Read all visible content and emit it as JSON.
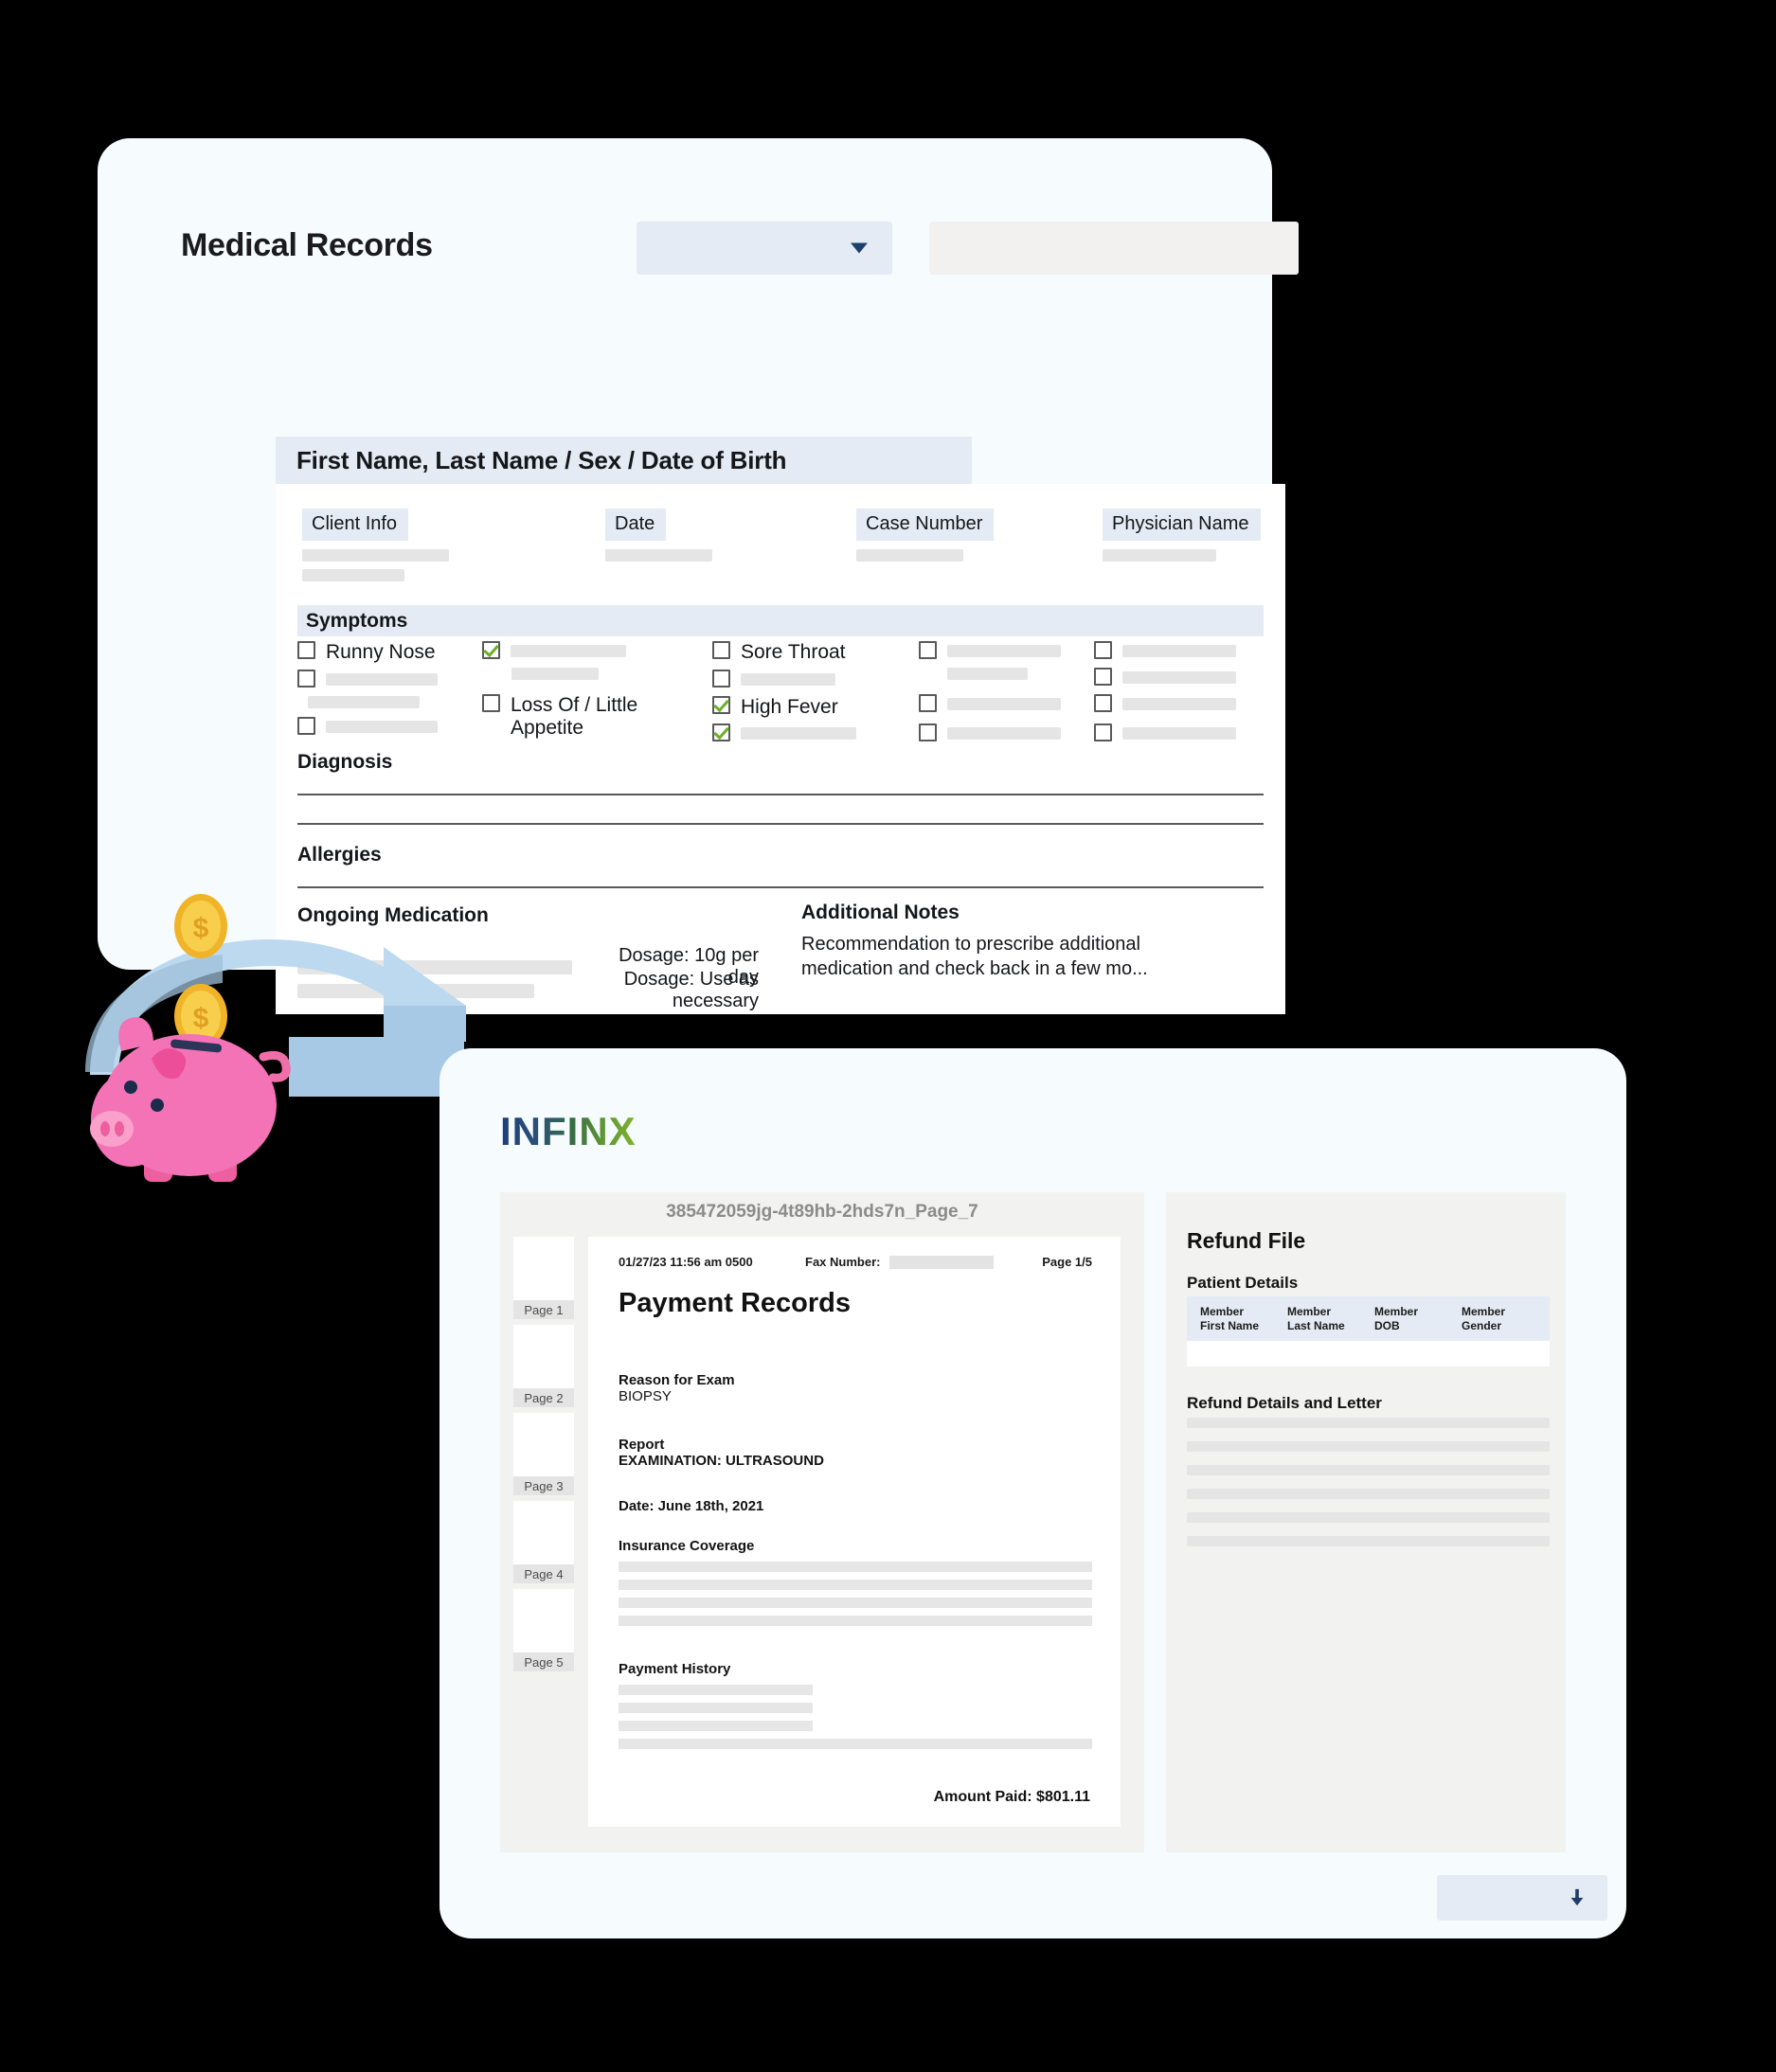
{
  "medical_card": {
    "title": "Medical Records",
    "select": {
      "value": "",
      "icon": "chevron-down-icon"
    },
    "textfield": {
      "value": ""
    },
    "name_bar": "First Name, Last Name / Sex / Date of Birth",
    "info_columns": [
      {
        "label": "Client Info",
        "bars": [
          155,
          108
        ]
      },
      {
        "label": "Date",
        "bars": [
          113
        ]
      },
      {
        "label": "Case Number",
        "bars": [
          113
        ]
      },
      {
        "label": "Physician Name",
        "bars": [
          120
        ]
      }
    ],
    "symptoms_header": "Symptoms",
    "symptoms": [
      {
        "checked": false,
        "label": "Runny Nose",
        "bar": 0
      },
      {
        "checked": false,
        "label": "",
        "bar": 118
      },
      {
        "checked": false,
        "label": "",
        "bar": 118
      },
      {
        "checked": true,
        "label": "",
        "bar": 122
      },
      {
        "checked": false,
        "label": "",
        "bar": 92
      },
      {
        "checked": false,
        "label": "Loss Of / Little\nAppetite",
        "bar": 0
      },
      {
        "checked": false,
        "label": "Sore Throat",
        "bar": 0
      },
      {
        "checked": false,
        "label": "",
        "bar": 100
      },
      {
        "checked": true,
        "label": "High Fever",
        "bar": 0
      },
      {
        "checked": true,
        "label": "",
        "bar": 122
      },
      {
        "checked": false,
        "label": "",
        "bar": 120
      },
      {
        "checked": false,
        "label": "",
        "bar": 85
      },
      {
        "checked": false,
        "label": "",
        "bar": 120
      },
      {
        "checked": false,
        "label": "",
        "bar": 120
      },
      {
        "checked": false,
        "label": "",
        "bar": 120
      },
      {
        "checked": false,
        "label": "",
        "bar": 120
      },
      {
        "checked": false,
        "label": "",
        "bar": 120
      },
      {
        "checked": false,
        "label": "",
        "bar": 120
      }
    ],
    "diagnosis_label": "Diagnosis",
    "allergies_label": "Allergies",
    "medication_label": "Ongoing Medication",
    "medications": [
      {
        "bar": 290,
        "dosage": "Dosage: 10g per day"
      },
      {
        "bar": 250,
        "dosage": "Dosage: Use as necessary"
      }
    ],
    "notes_label": "Additional Notes",
    "notes_text": "Recommendation to prescribe additional medication and check back in a few mo..."
  },
  "illustration": {
    "name": "piggy-bank-refund-illustration",
    "piggy_color": "#f472b6",
    "coin_color": "#f5c53b",
    "arrow_color": "#a9cbe8"
  },
  "infinx_card": {
    "logo": "INFINX",
    "viewer": {
      "filename": "385472059jg-4t89hb-2hds7n_Page_7",
      "thumbnails": [
        {
          "label": "Page 1"
        },
        {
          "label": "Page 2"
        },
        {
          "label": "Page 3"
        },
        {
          "label": "Page 4"
        },
        {
          "label": "Page 5"
        }
      ],
      "document": {
        "timestamp": "01/27/23 11:56 am 0500",
        "fax_label": "Fax Number:",
        "page_indicator": "Page 1/5",
        "title": "Payment Records",
        "sections": [
          {
            "heading": "Reason for Exam",
            "value": "BIOPSY"
          },
          {
            "heading": "Report",
            "value": "EXAMINATION: ULTRASOUND"
          },
          {
            "heading": "Date: June 18th, 2021",
            "value": ""
          }
        ],
        "insurance_heading": "Insurance Coverage",
        "insurance_bars": [
          100,
          100,
          100,
          100
        ],
        "payment_heading": "Payment History",
        "payment_bars": [
          41,
          41,
          41,
          100
        ],
        "amount_paid": "Amount Paid: $801.11"
      }
    },
    "refund": {
      "title": "Refund File",
      "patient_details_label": "Patient Details",
      "table_headers": [
        "Member\nFirst Name",
        "Member\nLast Name",
        "Member\nDOB",
        "Member\nGender"
      ],
      "table_row": [
        "",
        "",
        "",
        ""
      ],
      "details_label": "Refund Details and Letter",
      "detail_bars": [
        100,
        100,
        100,
        100,
        100,
        100
      ]
    },
    "download_button": {
      "label": "",
      "icon": "download-arrow-icon"
    }
  }
}
